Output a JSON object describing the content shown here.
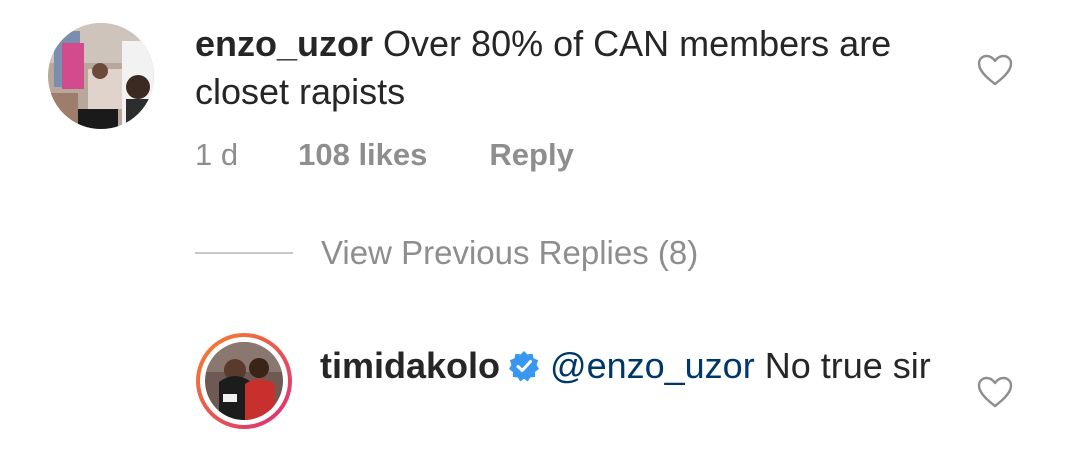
{
  "comment": {
    "username": "enzo_uzor",
    "text": "Over 80% of CAN members are closet rapists",
    "time": "1 d",
    "likes": "108 likes",
    "reply_label": "Reply",
    "like_icon": "heart-outline-icon"
  },
  "view_previous": {
    "label": "View Previous Replies (8)"
  },
  "reply": {
    "username": "timidakolo",
    "verified_icon": "verified-badge-icon",
    "mention": "@enzo_uzor",
    "text": "No true sir",
    "like_icon": "heart-outline-icon"
  },
  "colors": {
    "text": "#262626",
    "secondary": "#8e8e8e",
    "mention": "#00376b",
    "verified": "#3897f0",
    "story_ring_start": "#f58529",
    "story_ring_end": "#dd2a7b"
  }
}
